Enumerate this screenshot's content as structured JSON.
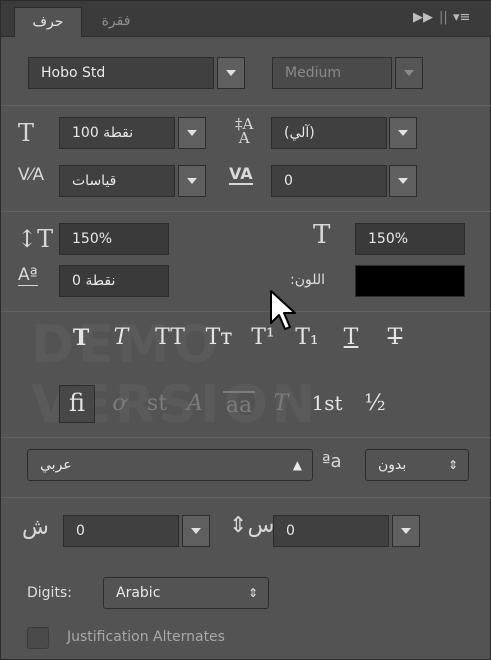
{
  "tabs": {
    "active": "حرف",
    "inactive": "فقرة",
    "collapse_icon": "double-arrow-right-icon",
    "menu_icon": "panel-menu-icon"
  },
  "font": {
    "family": "Hobo Std",
    "style": "Medium"
  },
  "size": {
    "font_size": "نقطة 100",
    "leading": "(آلي)",
    "kerning": "قياسات",
    "tracking": "0"
  },
  "scale": {
    "vertical": "150%",
    "horizontal": "150%",
    "baseline_shift": "نقطة 0",
    "color_label": ":اللون",
    "color_value": "#000000"
  },
  "watermark": "DEMO VERSION",
  "styles_row": [
    "T",
    "T",
    "TT",
    "Tт",
    "T¹",
    "T₁",
    "T",
    "T"
  ],
  "opentype_row": [
    "fi",
    "ơ",
    "st",
    "A",
    "aa",
    "T",
    "1st",
    "½"
  ],
  "language": {
    "value": "عربي",
    "aa_label": "ªa",
    "antialias": "بدون"
  },
  "kashida": {
    "left_value": "0",
    "right_value": "0"
  },
  "digits": {
    "label": "Digits:",
    "value": "Arabic"
  },
  "justification": {
    "label": "Justification Alternates"
  }
}
